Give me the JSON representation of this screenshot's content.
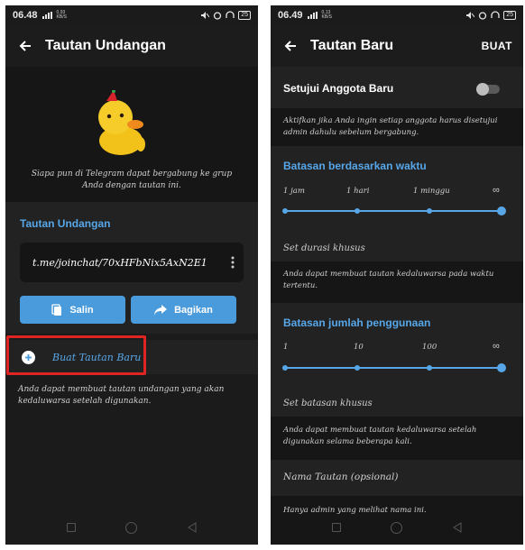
{
  "colors": {
    "accent": "#57a6e8",
    "button": "#4a9bdc",
    "highlight": "#e02424",
    "background": "#1b1b1b"
  },
  "left": {
    "status": {
      "time": "06.48",
      "signal_note": "⁴⁶",
      "speed_top": "0,93",
      "speed_bottom": "KB/S",
      "battery": "25"
    },
    "title": "Tautan Undangan",
    "hero_text": "Siapa pun di Telegram dapat bergabung ke grup Anda dengan tautan ini.",
    "section_title": "Tautan Undangan",
    "invite_link": "t.me/joinchat/70xHFbNix5AxN2E1",
    "copy_label": "Salin",
    "share_label": "Bagikan",
    "new_link_label": "Buat Tautan Baru",
    "footer": "Anda dapat membuat tautan undangan yang akan kedaluwarsa setelah digunakan.",
    "icons": [
      "back-arrow-icon",
      "duck-sticker-icon",
      "more-vert-icon",
      "copy-icon",
      "share-icon",
      "plus-icon"
    ]
  },
  "right": {
    "status": {
      "time": "06.49",
      "signal_note": "⁴⁶",
      "speed_top": "0,13",
      "speed_bottom": "KB/S",
      "battery": "25"
    },
    "title": "Tautan Baru",
    "create_label": "BUAT",
    "approve_label": "Setujui Anggota Baru",
    "approve_enabled": false,
    "approve_desc": "Aktifkan jika Anda ingin setiap anggota harus disetujui admin dahulu sebelum bergabung.",
    "time_section": {
      "title": "Batasan berdasarkan waktu",
      "ticks": [
        "1 jam",
        "1 hari",
        "1 minggu",
        "∞"
      ],
      "selected": "∞",
      "custom_label": "Set durasi khusus",
      "desc": "Anda dapat membuat tautan kedaluwarsa pada waktu tertentu."
    },
    "usage_section": {
      "title": "Batasan jumlah penggunaan",
      "ticks": [
        "1",
        "10",
        "100",
        "∞"
      ],
      "selected": "∞",
      "custom_label": "Set batasan khusus",
      "desc": "Anda dapat membuat tautan kedaluwarsa setelah digunakan selama beberapa kali."
    },
    "name_placeholder": "Nama Tautan (opsional)",
    "name_desc": "Hanya admin yang melihat nama ini."
  }
}
